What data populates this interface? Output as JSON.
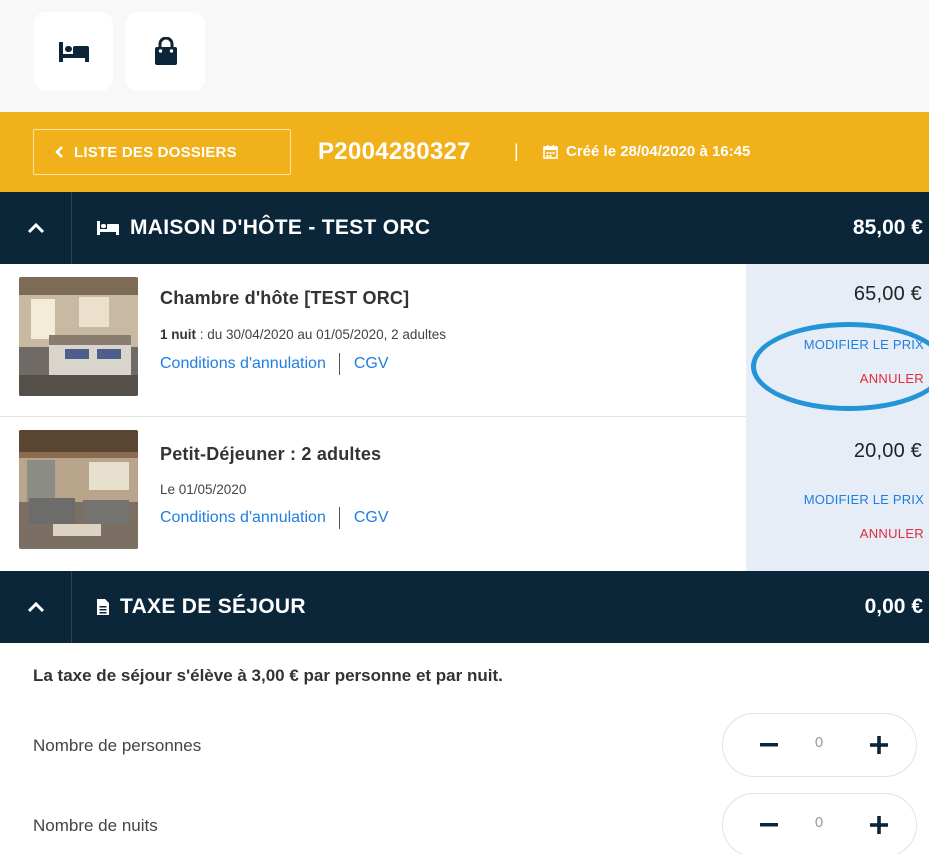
{
  "toolbar": {
    "icons": [
      "bed-icon",
      "shopping-bag-icon"
    ]
  },
  "dossier": {
    "back_label": "LISTE DES DOSSIERS",
    "number": "P2004280327",
    "separator": "|",
    "created": "Créé le 28/04/2020 à 16:45",
    "bar_color": "#f0b11a"
  },
  "lodging": {
    "title": "MAISON D'HÔTE - TEST ORC",
    "total": "85,00 €",
    "items": [
      {
        "name": "Chambre d'hôte [TEST ORC]",
        "meta_bold": "1 nuit",
        "meta": " : du 30/04/2020 au 01/05/2020, 2 adultes",
        "conditions": "Conditions d'annulation",
        "cgv": "CGV",
        "price": "65,00 €",
        "modify": "MODIFIER LE PRIX",
        "cancel": "ANNULER"
      },
      {
        "name": "Petit-Déjeuner : 2 adultes",
        "meta": "Le 01/05/2020",
        "conditions": "Conditions d'annulation",
        "cgv": "CGV",
        "price": "20,00 €",
        "modify": "MODIFIER LE PRIX",
        "cancel": "ANNULER"
      }
    ]
  },
  "tax": {
    "title": "TAXE DE SÉJOUR",
    "total": "0,00 €",
    "info": "La taxe de séjour s'élève à 3,00 € par personne et par nuit.",
    "counters": [
      {
        "label": "Nombre de personnes",
        "value": "0"
      },
      {
        "label": "Nombre de nuits",
        "value": "0"
      }
    ]
  },
  "colors": {
    "header_bg": "#0b2539",
    "link": "#1f7ee2",
    "danger": "#e22b3c",
    "price_col_bg": "#e6edf7",
    "annotation_ring": "#2394d6"
  }
}
